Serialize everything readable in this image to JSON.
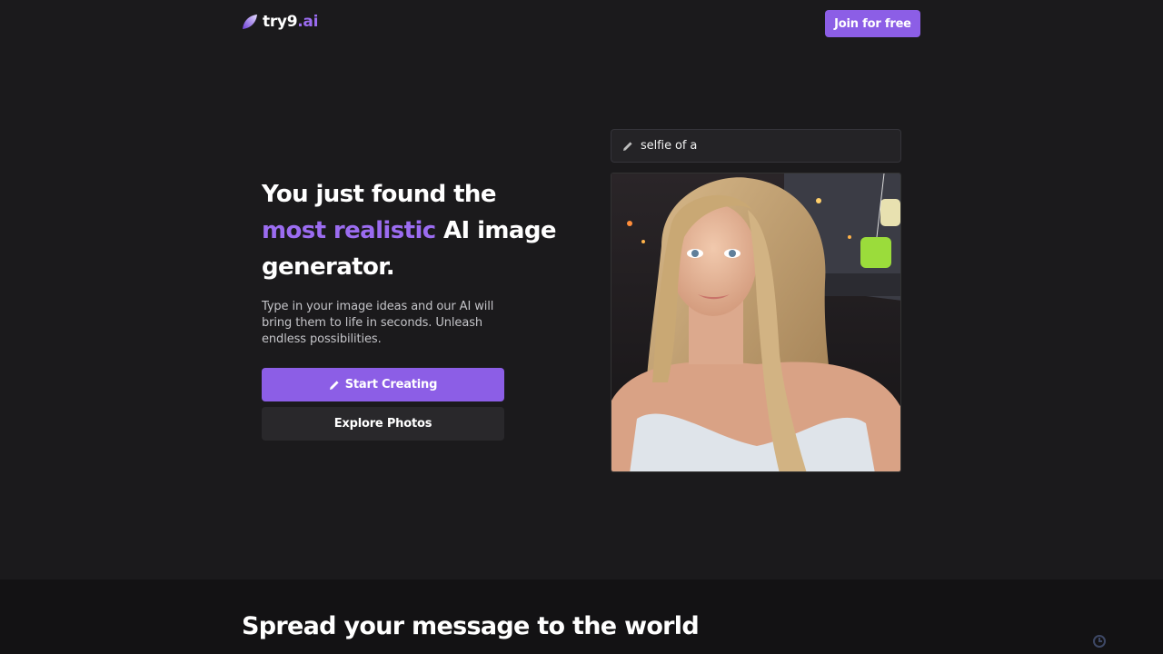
{
  "header": {
    "logo_text_main": "try9",
    "logo_text_accent": ".ai",
    "join_label": "Join for free"
  },
  "hero": {
    "headline_part1": "You just found the",
    "headline_highlight": "most realistic",
    "headline_part2": "AI image generator.",
    "subtext": "Type in your image ideas and our AI will bring them to life in seconds. Unleash endless possibilities.",
    "start_label": "Start Creating",
    "explore_label": "Explore Photos"
  },
  "prompt": {
    "icon": "pencil-icon",
    "text": "selfie of a"
  },
  "lower": {
    "title": "Spread your message to the world"
  },
  "colors": {
    "accent": "#8c5ee6",
    "highlight": "#9b6cf0",
    "background": "#1b1a1c"
  }
}
